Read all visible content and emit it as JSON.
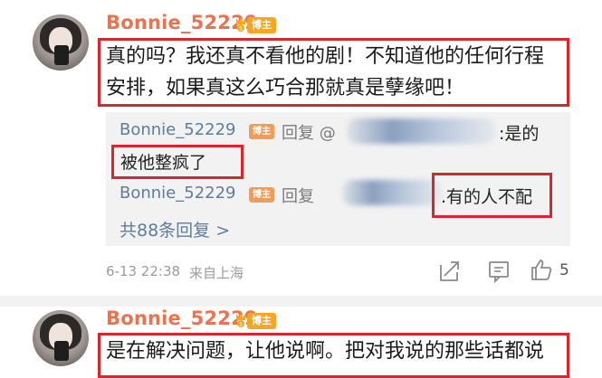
{
  "comment1": {
    "username": "Bonnie_52229",
    "badge": "博主",
    "line1": "真的吗？我还真不看他的剧！不知道他的任何行程",
    "line2": "安排，如果真这么巧合那就真是孽缘吧！",
    "replies": [
      {
        "username": "Bonnie_52229",
        "badge": "博主",
        "reply_word": "回复 @",
        "tail": ":是的",
        "text": "被他整疯了"
      },
      {
        "username": "Bonnie_52229",
        "badge": "博主",
        "reply_word": "回复",
        "tail": ".有的人不配"
      }
    ],
    "more_replies": "共88条回复 >",
    "date": "6-13 22:38",
    "location": "来自上海",
    "like_count": "5",
    "icons": [
      "share-icon",
      "comment-icon",
      "like-icon"
    ]
  },
  "comment2": {
    "username": "Bonnie_52229",
    "badge": "博主",
    "line1": "是在解决问题，让他说啊。把对我说的那些话都说"
  },
  "colors": {
    "username": "#eb7350",
    "reply_user": "#5f7d98",
    "highlight_box": "#d9262c",
    "panel": "#f2f2f2"
  }
}
